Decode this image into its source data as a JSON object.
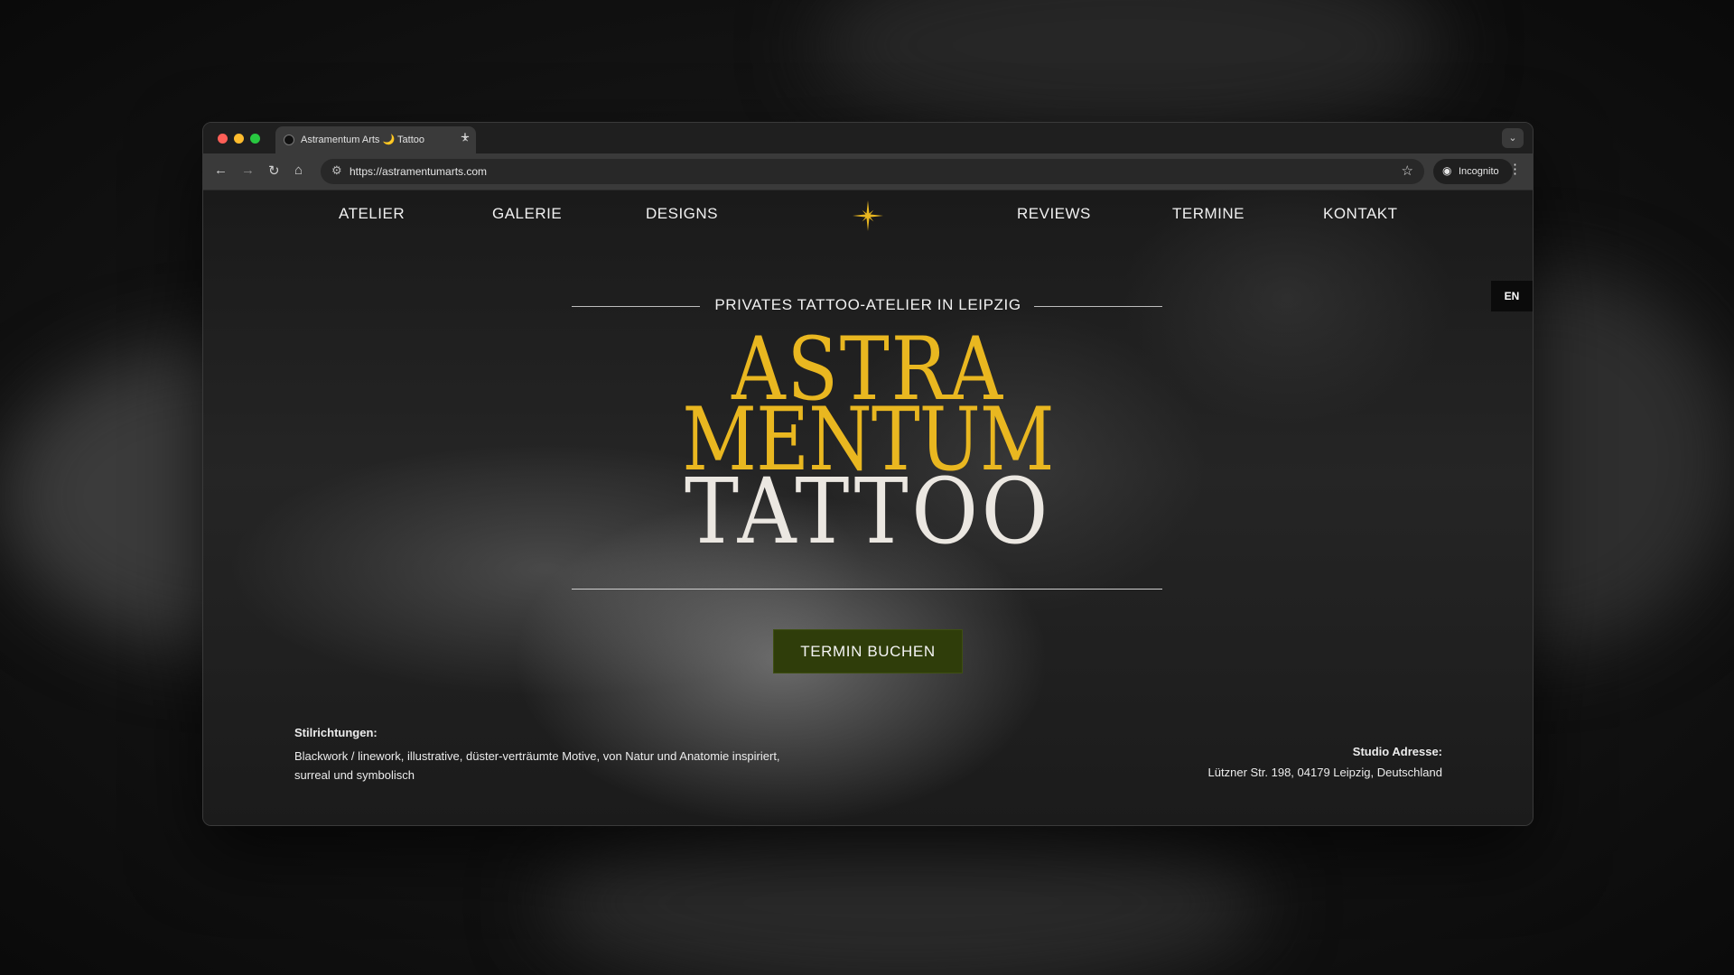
{
  "browser": {
    "tab_title": "Astramentum Arts 🌙 Tattoo",
    "tab_close": "×",
    "new_tab": "+",
    "url": "https://astramentumarts.com",
    "incognito_label": "Incognito"
  },
  "nav": {
    "items_left": [
      "ATELIER",
      "GALERIE",
      "DESIGNS"
    ],
    "items_right": [
      "REVIEWS",
      "TERMINE",
      "KONTAKT"
    ]
  },
  "language": "EN",
  "hero": {
    "kicker": "PRIVATES TATTOO-ATELIER IN LEIPZIG",
    "line1": "ASTRA",
    "line2": "MENTUM",
    "line3": "TATTOO",
    "cta": "TERMIN BUCHEN"
  },
  "info": {
    "styles_heading": "Stilrichtungen:",
    "styles_text": "Blackwork / linework, illustrative, düster-verträumte Motive, von Natur und Anatomie inspiriert, surreal und symbolisch",
    "address_heading": "Studio Adresse:",
    "address_text": "Lützner Str. 198, 04179 Leipzig, Deutschland"
  },
  "colors": {
    "accent_gold": "#e9b720",
    "cta_green": "#2f3d0a",
    "traffic_red": "#ff5f57",
    "traffic_yellow": "#febc2e",
    "traffic_green": "#28c840"
  }
}
